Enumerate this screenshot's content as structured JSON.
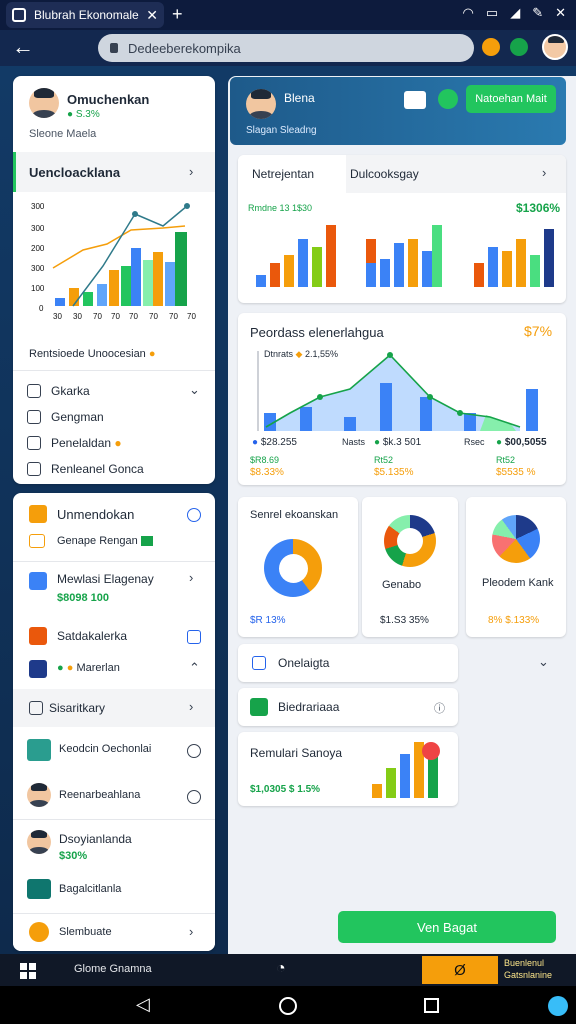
{
  "browser": {
    "tab_title": "Blubrah Ekonomale",
    "url": "Dedeeberekompika"
  },
  "sidebar_top": {
    "user_name": "Omuchenkan",
    "user_sub": "S.3%",
    "user_meta": "Sleone Maela",
    "section_title": "Uencloacklana",
    "chart_yticks": [
      "300",
      "300",
      "200",
      "300",
      "100",
      "0"
    ],
    "chart_xticks": [
      "30",
      "30",
      "70",
      "70",
      "70",
      "70",
      "70",
      "70"
    ],
    "footer_label": "Rentsioede Unoocesian",
    "menu": [
      {
        "label": "Gkarka"
      },
      {
        "label": "Gengman"
      },
      {
        "label": "Penelaldan"
      },
      {
        "label": "Renleanel Gonca"
      }
    ]
  },
  "sidebar_bottom": {
    "items": [
      {
        "label": "Unmendokan"
      },
      {
        "label": "Genape Rengan"
      },
      {
        "label": "Mewlasi Elagenay",
        "value": "$8098 100"
      },
      {
        "label": "Satdakalerka"
      },
      {
        "label": "Marerlan"
      },
      {
        "label": "Sisaritkary"
      },
      {
        "label": "Keodcin Oechonlai"
      },
      {
        "label": "Reenarbeahlana"
      },
      {
        "label": "Dsoyianlanda",
        "value": "$30%"
      },
      {
        "label": "Bagalcitlanla"
      },
      {
        "label": "Slembuate"
      }
    ]
  },
  "header": {
    "name": "Blena",
    "meta": "Slagan Sleadng",
    "button_label": "Natoehan Mait"
  },
  "bar_card": {
    "tab1": "Netrejentan",
    "tab2": "Dulcooksgay",
    "sub_label": "Rmdne 13 1$30",
    "value": "$1306%"
  },
  "area_card": {
    "title": "Peordass elenerlahgua",
    "value": "$7%",
    "legend1": "Dtnrats",
    "legend2": "2.1,55%",
    "stat1": "$28.255",
    "stat2": "$k.3 501",
    "stat3": "$00,5055",
    "sub1": "$R8.69",
    "sub2": "Nasts",
    "label_x1": "Rsec",
    "label_x2": "Rt52",
    "foot1": "$8.33%",
    "foot2": "$5.135%",
    "foot3": "$5535 %"
  },
  "pie_cards": [
    {
      "title": "Senrel ekoanskan",
      "value": "$R 13%"
    },
    {
      "title": "Genabo",
      "value": "$1.S3 35%"
    },
    {
      "title": "Pleodem Kank",
      "value": "8% $.133%"
    }
  ],
  "list_cards": [
    {
      "label": "Onelaigta"
    },
    {
      "label": "Biedrariaaa"
    }
  ],
  "mini_card": {
    "title": "Remulari Sanoya",
    "value": "$1,0305 $ 1.5%"
  },
  "cta_button": "Ven Bagat",
  "taskbar": {
    "label": "Glome Gnamna",
    "highlight": "Ø",
    "corner_line1": "Buenlenul",
    "corner_line2": "Gatsnlanine"
  },
  "colors": {
    "accent_green": "#22c55e",
    "blue": "#3b82f6",
    "orange": "#f59e0b",
    "dark_bg": "#0f2f52"
  }
}
